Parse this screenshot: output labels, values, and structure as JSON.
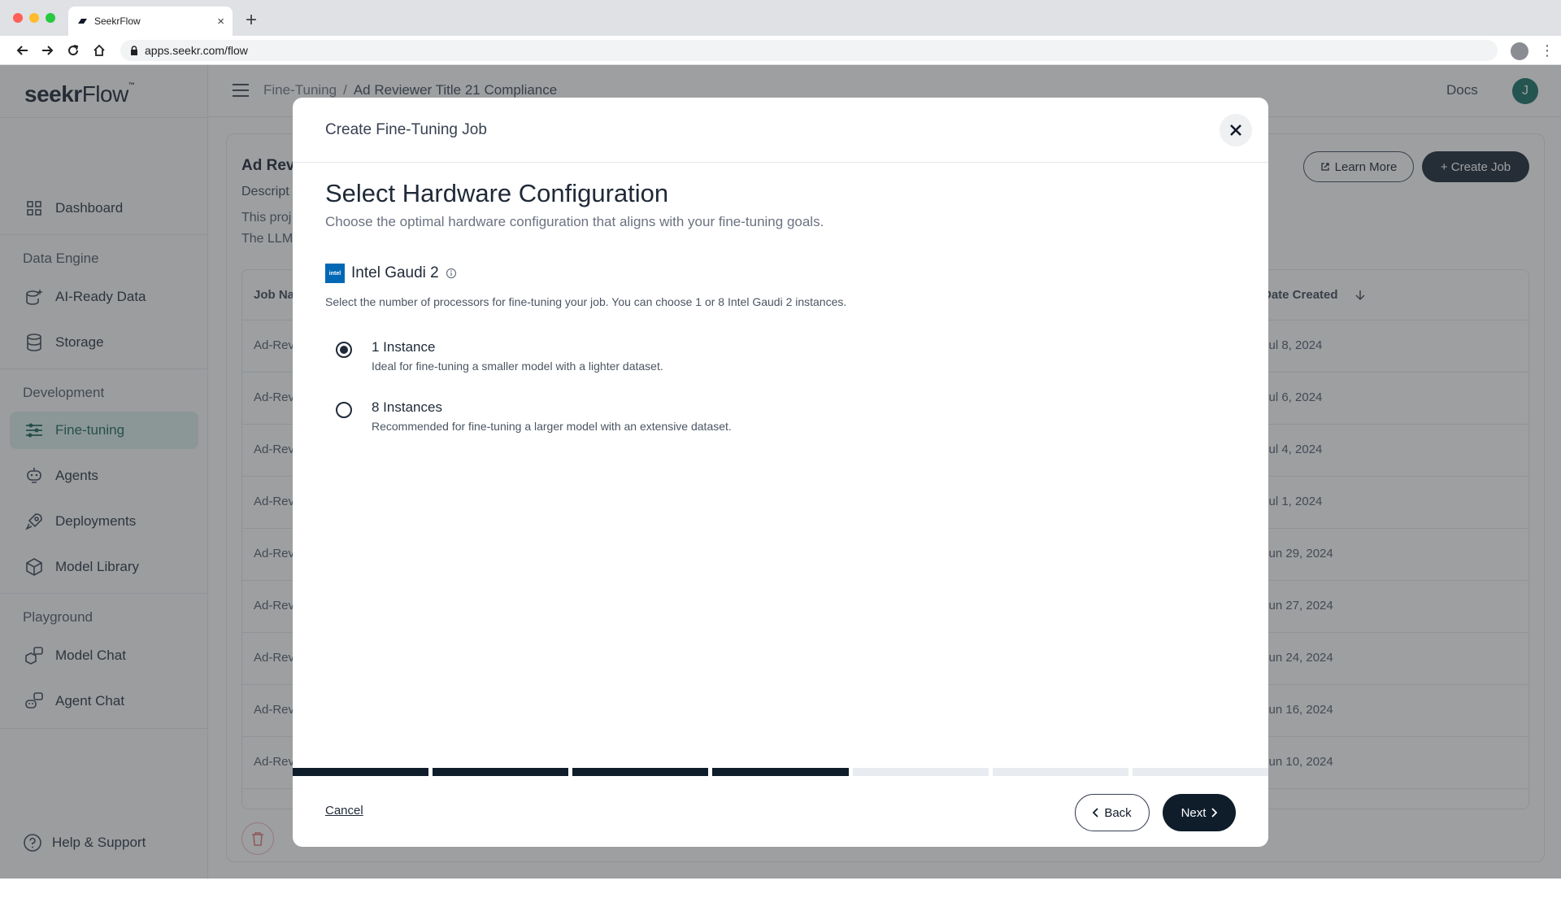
{
  "browser": {
    "tab_title": "SeekrFlow",
    "url": "apps.seekr.com/flow",
    "new_tab": "+",
    "tab_close": "×"
  },
  "app": {
    "brand_seekr": "seekr",
    "brand_flow": "Flow",
    "brand_tm": "™",
    "breadcrumb": {
      "parent": "Fine-Tuning",
      "separator": "/",
      "current": "Ad Reviewer Title 21 Compliance"
    },
    "docs_label": "Docs",
    "avatar_initial": "J",
    "sidebar": {
      "dashboard": "Dashboard",
      "section_data_engine": "Data Engine",
      "ai_ready_data": "AI-Ready Data",
      "storage": "Storage",
      "section_development": "Development",
      "fine_tuning": "Fine-tuning",
      "agents": "Agents",
      "deployments": "Deployments",
      "model_library": "Model Library",
      "section_playground": "Playground",
      "model_chat": "Model Chat",
      "agent_chat": "Agent Chat",
      "help": "Help & Support"
    },
    "project": {
      "title_partial": "Ad Revi",
      "desc_label_partial": "Descript",
      "desc_line1_partial": "This proj",
      "desc_line2_partial": "The LLM"
    },
    "buttons": {
      "learn_more": "Learn More",
      "create_job": "+ Create Job"
    },
    "table": {
      "col_job_partial": "Job Na",
      "col_date": "Date Created",
      "rows": [
        {
          "name": "Ad-Rev",
          "date": "Jul 8, 2024"
        },
        {
          "name": "Ad-Rev",
          "date": "Jul 6, 2024"
        },
        {
          "name": "Ad-Rev",
          "date": "Jul 4, 2024"
        },
        {
          "name": "Ad-Rev",
          "date": "Jul 1, 2024"
        },
        {
          "name": "Ad-Rev",
          "date": "Jun 29, 2024"
        },
        {
          "name": "Ad-Rev",
          "date": "Jun 27, 2024"
        },
        {
          "name": "Ad-Rev",
          "date": "Jun 24, 2024"
        },
        {
          "name": "Ad-Rev",
          "date": "Jun 16, 2024"
        },
        {
          "name": "Ad-Rev",
          "date": "Jun 10, 2024"
        }
      ]
    }
  },
  "modal": {
    "title": "Create Fine-Tuning Job",
    "heading": "Select Hardware Configuration",
    "subheading": "Choose the optimal hardware configuration that aligns with your fine-tuning goals.",
    "hardware_name": "Intel Gaudi 2",
    "intel_logo_text": "intel",
    "hardware_desc": "Select the number of processors for fine-tuning your job. You can choose 1 or 8 Intel Gaudi 2 instances.",
    "options": [
      {
        "label": "1 Instance",
        "desc": "Ideal for fine-tuning a smaller model with a lighter dataset.",
        "selected": true
      },
      {
        "label": "8 Instances",
        "desc": "Recommended for fine-tuning a larger model with an extensive dataset.",
        "selected": false
      }
    ],
    "progress": {
      "total_steps": 7,
      "completed_steps": 4
    },
    "cancel_label": "Cancel",
    "back_label": "Back",
    "next_label": "Next"
  },
  "colors": {
    "primary_dark": "#0f1d2b",
    "active_nav_bg": "#dbeee9",
    "intel_blue": "#0068b5"
  }
}
